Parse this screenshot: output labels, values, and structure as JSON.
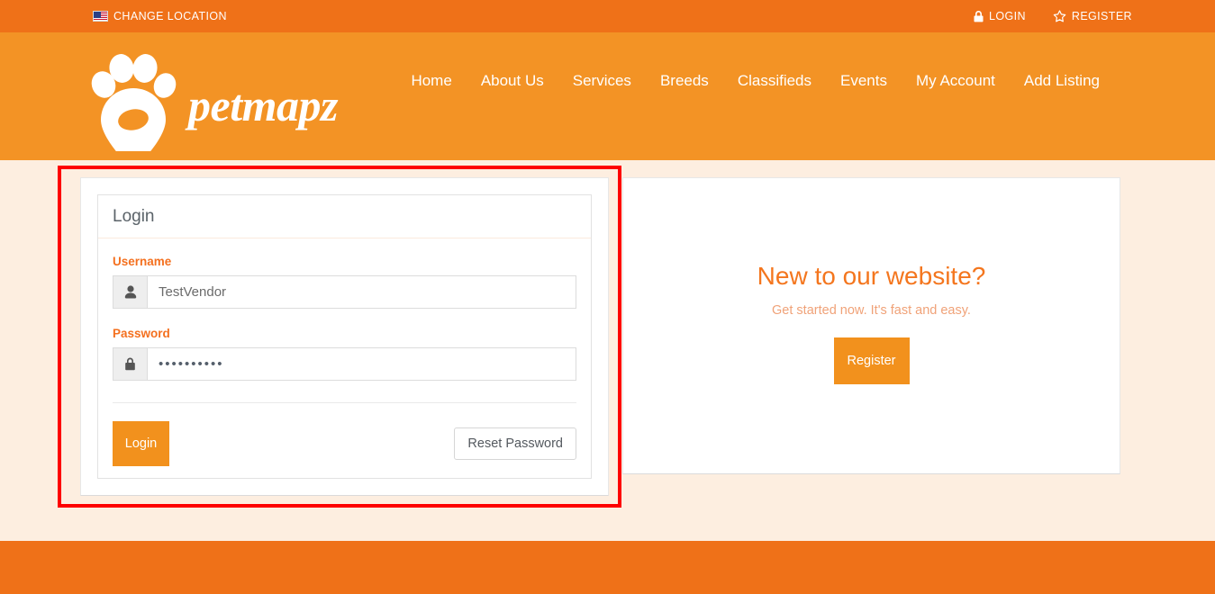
{
  "topbar": {
    "change_location": {
      "label": "CHANGE LOCATION",
      "icon": "us-flag-icon"
    },
    "login": {
      "label": "LOGIN",
      "icon": "lock-icon"
    },
    "register": {
      "label": "REGISTER",
      "icon": "star-icon"
    }
  },
  "header": {
    "logo": {
      "wordmark": "petmapz",
      "icon": "paw-map-pin-icon"
    },
    "nav": [
      {
        "label": "Home"
      },
      {
        "label": "About Us"
      },
      {
        "label": "Services"
      },
      {
        "label": "Breeds"
      },
      {
        "label": "Classifieds"
      },
      {
        "label": "Events"
      },
      {
        "label": "My Account"
      },
      {
        "label": "Add Listing"
      }
    ]
  },
  "login_panel": {
    "title": "Login",
    "username": {
      "label": "Username",
      "value": "TestVendor",
      "placeholder": "Username",
      "icon": "user-icon"
    },
    "password": {
      "label": "Password",
      "value": "..........",
      "placeholder": "Password",
      "icon": "lock-icon"
    },
    "submit_label": "Login",
    "reset_label": "Reset Password"
  },
  "register_panel": {
    "title": "New to our website?",
    "subtitle": "Get started now. It's fast and easy.",
    "button_label": "Register"
  },
  "colors": {
    "topbar_orange": "#ef7118",
    "header_orange": "#f39325",
    "button_orange": "#f2911d",
    "accent_orange": "#f4701f",
    "page_background": "#fdeee0",
    "annotation_red": "#fe0000"
  }
}
